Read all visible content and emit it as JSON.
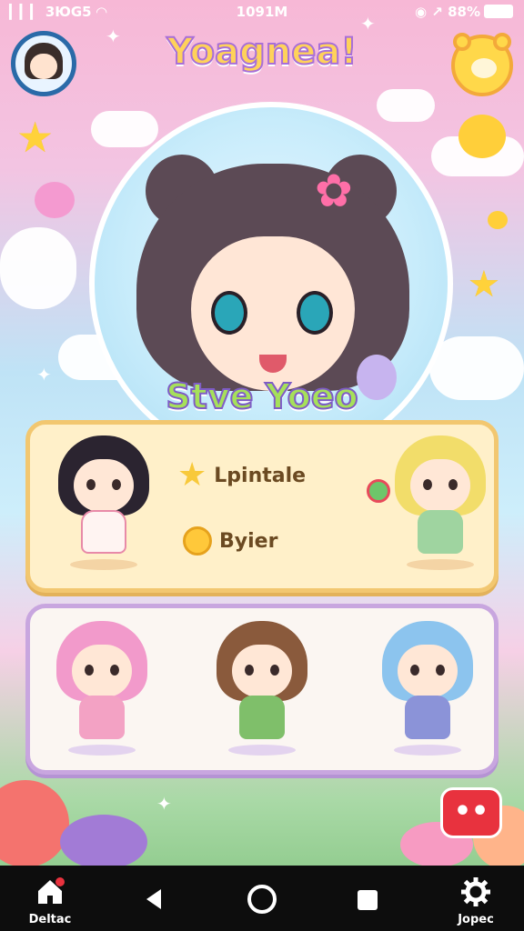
{
  "status_bar": {
    "left": "▎▎▎ 3ЮG5 ◠",
    "time": "1091M",
    "right": "◉ ↗ 88%"
  },
  "header": {
    "app_title": "Yoagnea!",
    "avatar_icon": "avatar-girl-icon",
    "menu_icon": "bear-face-icon"
  },
  "hero": {
    "subtitle": "Stve Yoeo"
  },
  "feature_card": {
    "items": [
      {
        "icon": "star-icon",
        "label": "Lpintale"
      },
      {
        "icon": "coin-icon",
        "label": "Byier"
      }
    ]
  },
  "characters": [
    {
      "name": "black-hair",
      "hair": "#2b2430",
      "outfit": "#fff4f2"
    },
    {
      "name": "blonde-hair",
      "hair": "#f2dd6a",
      "outfit": "#9fd4a0"
    },
    {
      "name": "pink-hair",
      "hair": "#f29acb",
      "outfit": "#f3a2c4"
    },
    {
      "name": "brown-hair",
      "hair": "#8a5a3c",
      "outfit": "#7fbf6a"
    },
    {
      "name": "blue-hair",
      "hair": "#8cc4ee",
      "outfit": "#8b93d8"
    }
  ],
  "chat_button": {
    "label": "••"
  },
  "nav_bar": {
    "home_label": "Deltac",
    "settings_label": "Jopec"
  },
  "colors": {
    "accent_red": "#e8323e",
    "card_yellow": "#fff0c9",
    "card_border_purple": "#c8a6df",
    "title_fill": "#ffd25a"
  }
}
